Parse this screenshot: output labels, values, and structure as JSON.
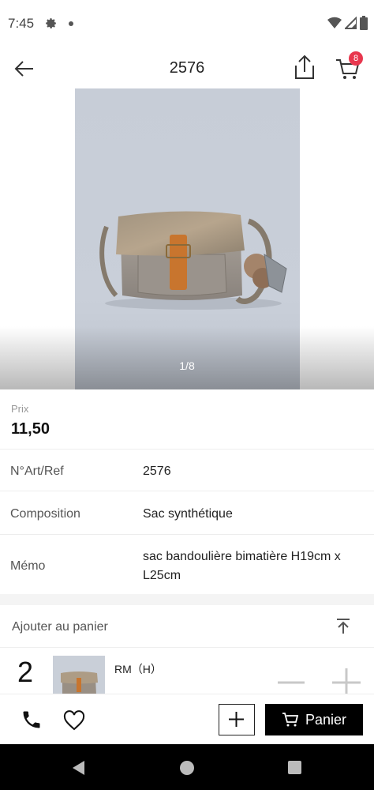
{
  "status_bar": {
    "time": "7:45",
    "icons": [
      "gear-icon",
      "notification-dot",
      "wifi-icon",
      "signal-icon",
      "battery-icon"
    ]
  },
  "header": {
    "title": "2576",
    "cart_count": "8"
  },
  "gallery": {
    "counter": "1/8"
  },
  "price": {
    "label": "Prix",
    "value": "11,50"
  },
  "details": [
    {
      "label": "N°Art/Ref",
      "value": "2576"
    },
    {
      "label": "Composition",
      "value": "Sac synthétique"
    },
    {
      "label": "Mémo",
      "value": "sac bandoulière bimatière H19cm x L25cm"
    }
  ],
  "add_to_cart": {
    "title": "Ajouter au panier",
    "item": {
      "quantity": "2",
      "name": "RM（H）"
    }
  },
  "bottom_bar": {
    "panier_label": "Panier"
  },
  "colors": {
    "accent_badge": "#e8374e",
    "primary_button": "#000000",
    "photo_background": "#c9cfd9",
    "bag_tan": "#a89a8a",
    "strap_orange": "#c8752e"
  }
}
